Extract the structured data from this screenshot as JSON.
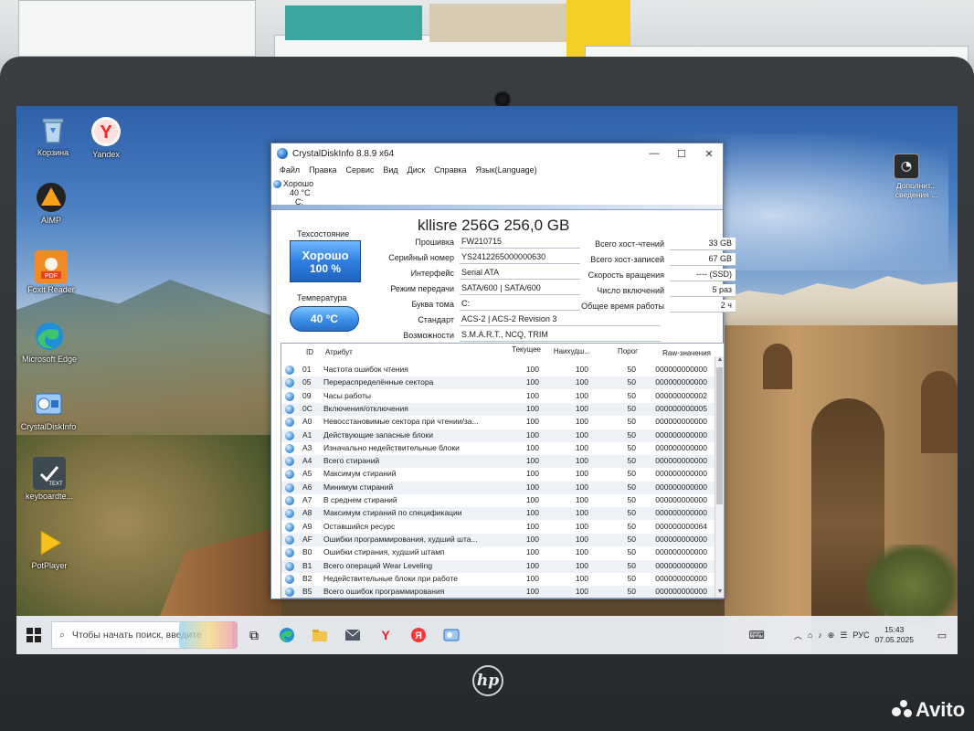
{
  "desktop": {
    "icons": [
      {
        "label": "Корзина",
        "icon": "recycle-bin-icon"
      },
      {
        "label": "Yandex",
        "icon": "yandex-browser-icon"
      },
      {
        "label": "AIMP",
        "icon": "aimp-icon"
      },
      {
        "label": "Foxit Reader",
        "icon": "foxit-pdf-icon"
      },
      {
        "label": "Microsoft Edge",
        "icon": "edge-icon"
      },
      {
        "label": "CrystalDiskInfo",
        "icon": "crystaldiskinfo-icon"
      },
      {
        "label": "keyboardte...",
        "icon": "text-file-icon"
      },
      {
        "label": "PotPlayer",
        "icon": "potplayer-icon"
      }
    ],
    "right_icon_label": "Дополнит... сведения ..."
  },
  "window": {
    "title": "CrystalDiskInfo 8.8.9 x64",
    "menu": [
      "Файл",
      "Правка",
      "Сервис",
      "Вид",
      "Диск",
      "Справка",
      "Язык(Language)"
    ],
    "drive_tab": {
      "status": "Хорошо",
      "temp": "40 °C",
      "letter": "C:"
    },
    "disk_title": "kllisre 256G 256,0 GB",
    "health_label": "Техсостояние",
    "health_status": "Хорошо",
    "health_percent": "100 %",
    "temp_label": "Температура",
    "temp_value": "40 °C",
    "info": {
      "firmware_label": "Прошивка",
      "firmware": "FW210715",
      "serial_label": "Серийный номер",
      "serial": "YS2412265000000630",
      "interface_label": "Интерфейс",
      "interface": "Serial ATA",
      "transfer_label": "Режим передачи",
      "transfer": "SATA/600 | SATA/600",
      "volume_label": "Буква тома",
      "volume": "C:",
      "standard_label": "Стандарт",
      "standard": "ACS-2 | ACS-2 Revision 3",
      "features_label": "Возможности",
      "features": "S.M.A.R.T., NCQ, TRIM",
      "host_reads_label": "Всего хост-чтений",
      "host_reads": "33 GB",
      "host_writes_label": "Всего хост-записей",
      "host_writes": "67 GB",
      "rotation_label": "Скорость вращения",
      "rotation": "---- (SSD)",
      "power_count_label": "Число включений",
      "power_count": "5 раз",
      "power_hours_label": "Общее время работы",
      "power_hours": "2 ч"
    },
    "smart_headers": {
      "id": "ID",
      "attr": "Атрибут",
      "cur": "Текущее",
      "worst": "Наихудш...",
      "thr": "Порог",
      "raw": "Raw-значения"
    },
    "smart_rows": [
      {
        "id": "01",
        "name": "Частота ошибок чтения",
        "cur": "100",
        "worst": "100",
        "thr": "50",
        "raw": "000000000000"
      },
      {
        "id": "05",
        "name": "Перераспределённые сектора",
        "cur": "100",
        "worst": "100",
        "thr": "50",
        "raw": "000000000000"
      },
      {
        "id": "09",
        "name": "Часы работы",
        "cur": "100",
        "worst": "100",
        "thr": "50",
        "raw": "000000000002"
      },
      {
        "id": "0C",
        "name": "Включения/отключения",
        "cur": "100",
        "worst": "100",
        "thr": "50",
        "raw": "000000000005"
      },
      {
        "id": "A0",
        "name": "Невосстановимые сектора при чтении/за...",
        "cur": "100",
        "worst": "100",
        "thr": "50",
        "raw": "000000000000"
      },
      {
        "id": "A1",
        "name": "Действующие запасные блоки",
        "cur": "100",
        "worst": "100",
        "thr": "50",
        "raw": "000000000000"
      },
      {
        "id": "A3",
        "name": "Изначально недействительные блоки",
        "cur": "100",
        "worst": "100",
        "thr": "50",
        "raw": "000000000000"
      },
      {
        "id": "A4",
        "name": "Всего стираний",
        "cur": "100",
        "worst": "100",
        "thr": "50",
        "raw": "000000000000"
      },
      {
        "id": "A5",
        "name": "Максимум стираний",
        "cur": "100",
        "worst": "100",
        "thr": "50",
        "raw": "000000000000"
      },
      {
        "id": "A6",
        "name": "Минимум стираний",
        "cur": "100",
        "worst": "100",
        "thr": "50",
        "raw": "000000000000"
      },
      {
        "id": "A7",
        "name": "В среднем стираний",
        "cur": "100",
        "worst": "100",
        "thr": "50",
        "raw": "000000000000"
      },
      {
        "id": "A8",
        "name": "Максимум стираний по спецификации",
        "cur": "100",
        "worst": "100",
        "thr": "50",
        "raw": "000000000000"
      },
      {
        "id": "A9",
        "name": "Оставшийся ресурс",
        "cur": "100",
        "worst": "100",
        "thr": "50",
        "raw": "000000000064"
      },
      {
        "id": "AF",
        "name": "Ошибки программирования, худший шта...",
        "cur": "100",
        "worst": "100",
        "thr": "50",
        "raw": "000000000000"
      },
      {
        "id": "B0",
        "name": "Ошибки стирания, худший штамп",
        "cur": "100",
        "worst": "100",
        "thr": "50",
        "raw": "000000000000"
      },
      {
        "id": "B1",
        "name": "Всего операций Wear Leveling",
        "cur": "100",
        "worst": "100",
        "thr": "50",
        "raw": "000000000000"
      },
      {
        "id": "B2",
        "name": "Недействительные блоки при работе",
        "cur": "100",
        "worst": "100",
        "thr": "50",
        "raw": "000000000000"
      },
      {
        "id": "B5",
        "name": "Всего ошибок программирования",
        "cur": "100",
        "worst": "100",
        "thr": "50",
        "raw": "000000000000"
      }
    ]
  },
  "taskbar": {
    "search_placeholder": "Чтобы начать поиск, введите",
    "lang": "РУС",
    "time": "15:43",
    "date": "07.05.2025"
  },
  "laptop": {
    "brand": "hp"
  },
  "watermark": "Avito"
}
